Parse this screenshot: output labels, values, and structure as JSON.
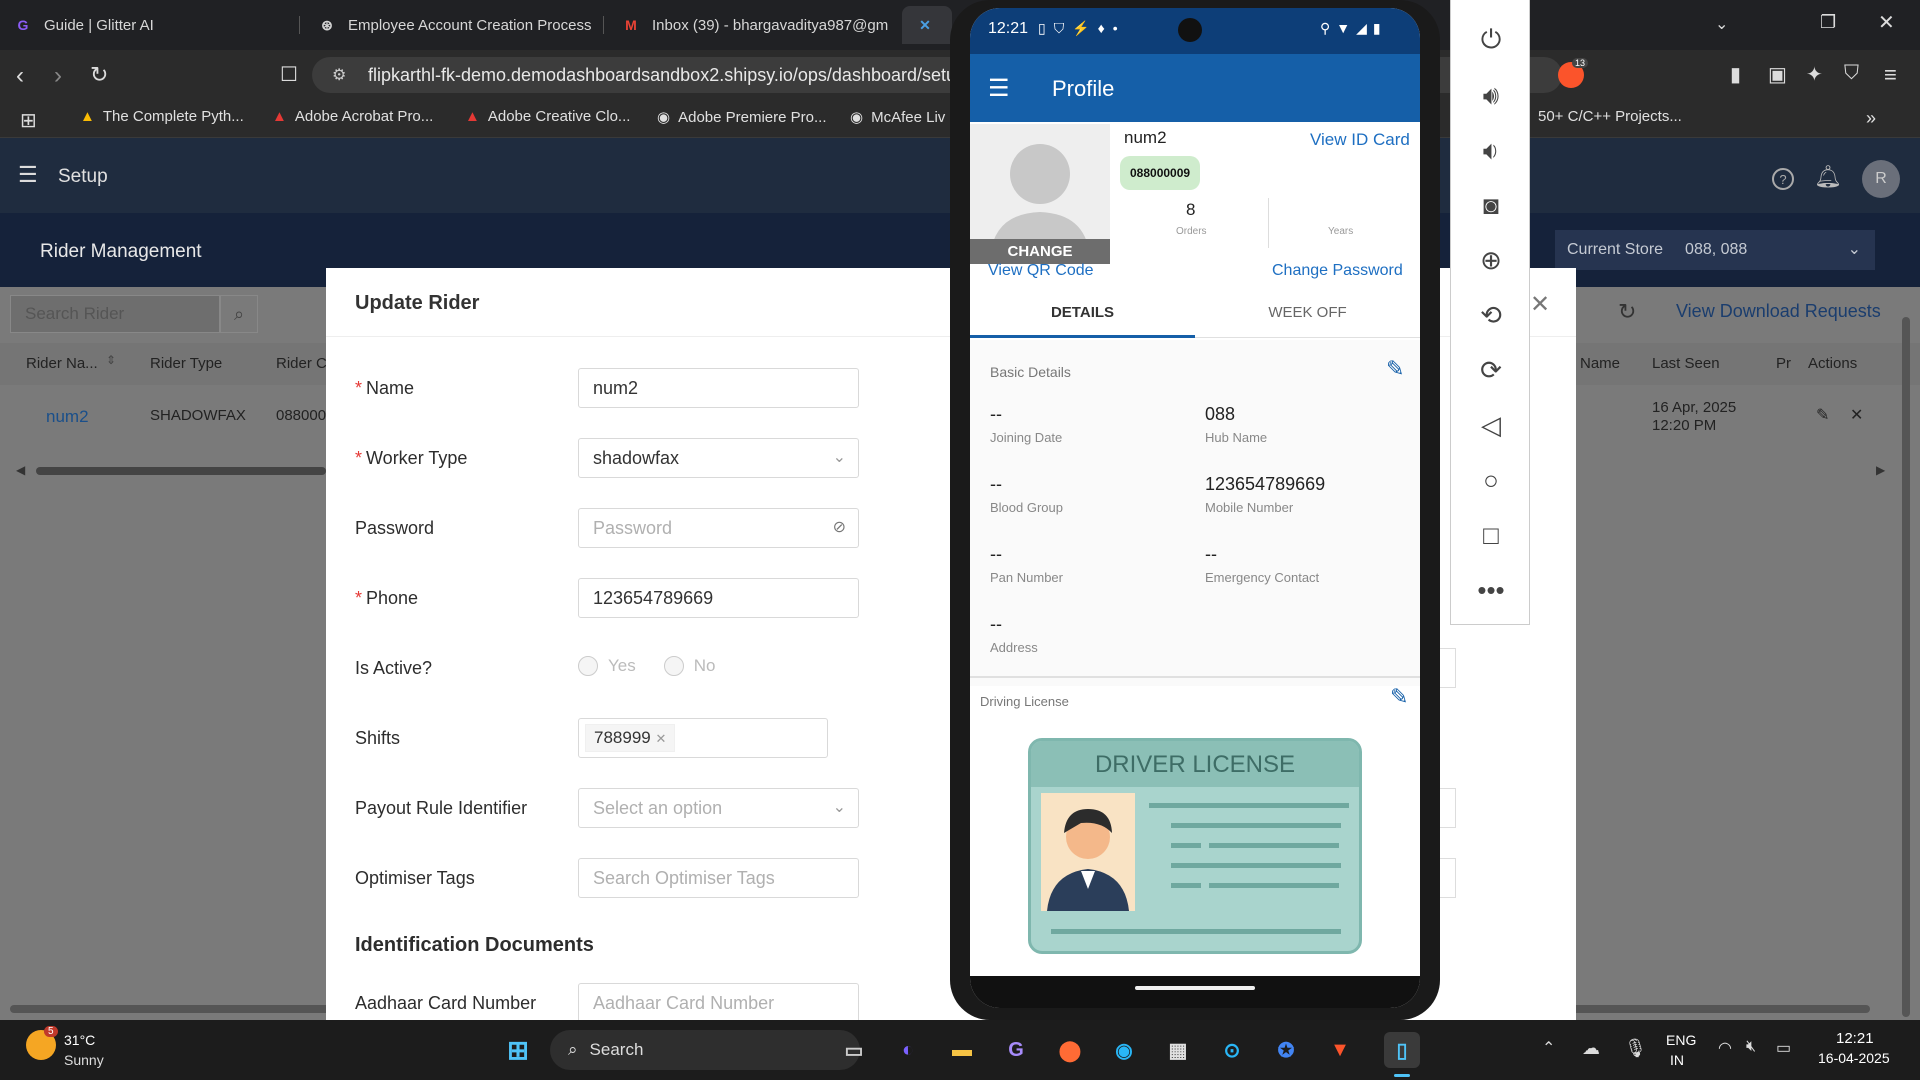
{
  "browser": {
    "tabs": [
      {
        "title": "Guide | Glitter AI",
        "icon": "glitter-icon"
      },
      {
        "title": "Employee Account Creation Process",
        "icon": "chatgpt-icon"
      },
      {
        "title": "Inbox (39) - bhargavaditya987@gm",
        "icon": "gmail-icon"
      },
      {
        "title": "",
        "icon": "shipsy-icon"
      }
    ],
    "url": "flipkarthl-fk-demo.demodashboardsandbox2.shipsy.io/ops/dashboard/setu",
    "bookmarks": [
      "The Complete Pyth...",
      "Adobe Acrobat Pro...",
      "Adobe Creative Clo...",
      "Adobe Premiere Pro...",
      "McAfee Liv",
      "50+ C/C++ Projects..."
    ],
    "bookmark_overflow": "»",
    "extension_badge": "13"
  },
  "app": {
    "header_title": "Setup",
    "avatar_letter": "R",
    "page_title": "Rider Management",
    "store_label": "Current Store",
    "store_value": "088, 088",
    "search_placeholder": "Search Rider",
    "download_link": "View Download Requests",
    "table": {
      "headers": [
        "Rider Na...",
        "Rider Type",
        "Rider C",
        "Name",
        "Last Seen",
        "Pr",
        "Actions"
      ],
      "row": {
        "name": "num2",
        "type": "SHADOWFAX",
        "code": "088000",
        "last_seen_date": "16 Apr, 2025",
        "last_seen_time": "12:20 PM"
      }
    }
  },
  "modal": {
    "title": "Update Rider",
    "fields": {
      "name_label": "Name",
      "name_value": "num2",
      "worker_label": "Worker Type",
      "worker_value": "shadowfax",
      "password_label": "Password",
      "password_placeholder": "Password",
      "phone_label": "Phone",
      "phone_value": "123654789669",
      "active_label": "Is Active?",
      "yes": "Yes",
      "no": "No",
      "shifts_label": "Shifts",
      "shift_tag": "788999",
      "payout_label": "Payout Rule Identifier",
      "payout_placeholder": "Select an option",
      "tags_label": "Optimiser Tags",
      "tags_placeholder": "Search Optimiser Tags",
      "section_title": "Identification Documents",
      "aadhaar_label": "Aadhaar Card Number",
      "aadhaar_placeholder": "Aadhaar Card Number"
    }
  },
  "phone": {
    "time": "12:21",
    "app_title": "Profile",
    "change": "CHANGE",
    "name": "num2",
    "id": "088000009",
    "view_id": "View ID Card",
    "orders_value": "8",
    "orders_label": "Orders",
    "years_label": "Years",
    "view_qr": "View QR Code",
    "change_password": "Change Password",
    "tab_details": "DETAILS",
    "tab_weekoff": "WEEK OFF",
    "basic_details": "Basic Details",
    "details": [
      {
        "value": "--",
        "label": "Joining Date"
      },
      {
        "value": "088",
        "label": "Hub Name"
      },
      {
        "value": "--",
        "label": "Blood Group"
      },
      {
        "value": "123654789669",
        "label": "Mobile Number"
      },
      {
        "value": "--",
        "label": "Pan Number"
      },
      {
        "value": "--",
        "label": "Emergency Contact"
      },
      {
        "value": "--",
        "label": "Address"
      }
    ],
    "driving_license": "Driving License",
    "license_title": "DRIVER LICENSE"
  },
  "taskbar": {
    "weather_temp": "31°C",
    "weather_desc": "Sunny",
    "weather_badge": "5",
    "search": "Search",
    "lang1": "ENG",
    "lang2": "IN",
    "time": "12:21",
    "date": "16-04-2025"
  }
}
